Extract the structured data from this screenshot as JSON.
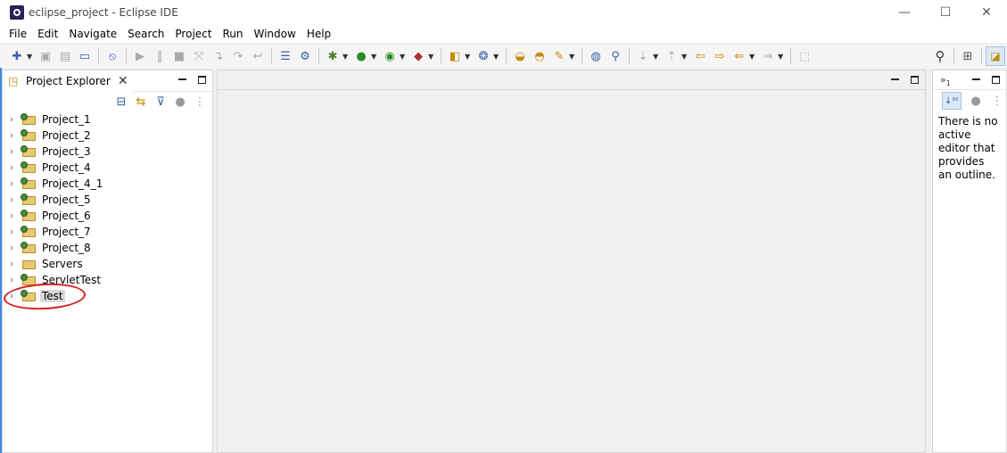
{
  "window": {
    "title": "eclipse_project - Eclipse IDE",
    "minimize": "—",
    "maximize": "☐",
    "close": "✕"
  },
  "menu": [
    "File",
    "Edit",
    "Navigate",
    "Search",
    "Project",
    "Run",
    "Window",
    "Help"
  ],
  "toolbar_icons": [
    "new-icon",
    "save-icon",
    "save-all-icon",
    "terminal-icon",
    "skip-breakpoints-icon",
    "resume-icon",
    "suspend-icon",
    "terminate-icon",
    "disconnect-icon",
    "step-into-icon",
    "step-over-icon",
    "step-return-icon",
    "build-icon",
    "debug-icon",
    "run-icon",
    "coverage-icon",
    "external-tools-icon",
    "new-server-icon",
    "new-class-icon",
    "open-type-icon",
    "open-task-icon",
    "open-resource-icon",
    "globe-icon",
    "run-ant-icon",
    "next-annotation-icon",
    "prev-annotation-icon",
    "last-edit-icon",
    "back-icon",
    "forward-icon",
    "pin-icon",
    "search-icon",
    "open-perspective-icon",
    "perspective-icon"
  ],
  "explorer": {
    "title": "Project Explorer",
    "close": "✕",
    "items": [
      {
        "label": "Project_1"
      },
      {
        "label": "Project_2"
      },
      {
        "label": "Project_3"
      },
      {
        "label": "Project_4"
      },
      {
        "label": "Project_4_1"
      },
      {
        "label": "Project_5"
      },
      {
        "label": "Project_6"
      },
      {
        "label": "Project_7"
      },
      {
        "label": "Project_8"
      },
      {
        "label": "Servers"
      },
      {
        "label": "ServletTest"
      },
      {
        "label": "Test"
      }
    ]
  },
  "outline": {
    "chevron": "»",
    "count": "1",
    "message": "There is no active editor that provides an outline."
  },
  "colors": {
    "annotation_circle": "#d21e1e",
    "edge_line": "#3c8be0"
  }
}
